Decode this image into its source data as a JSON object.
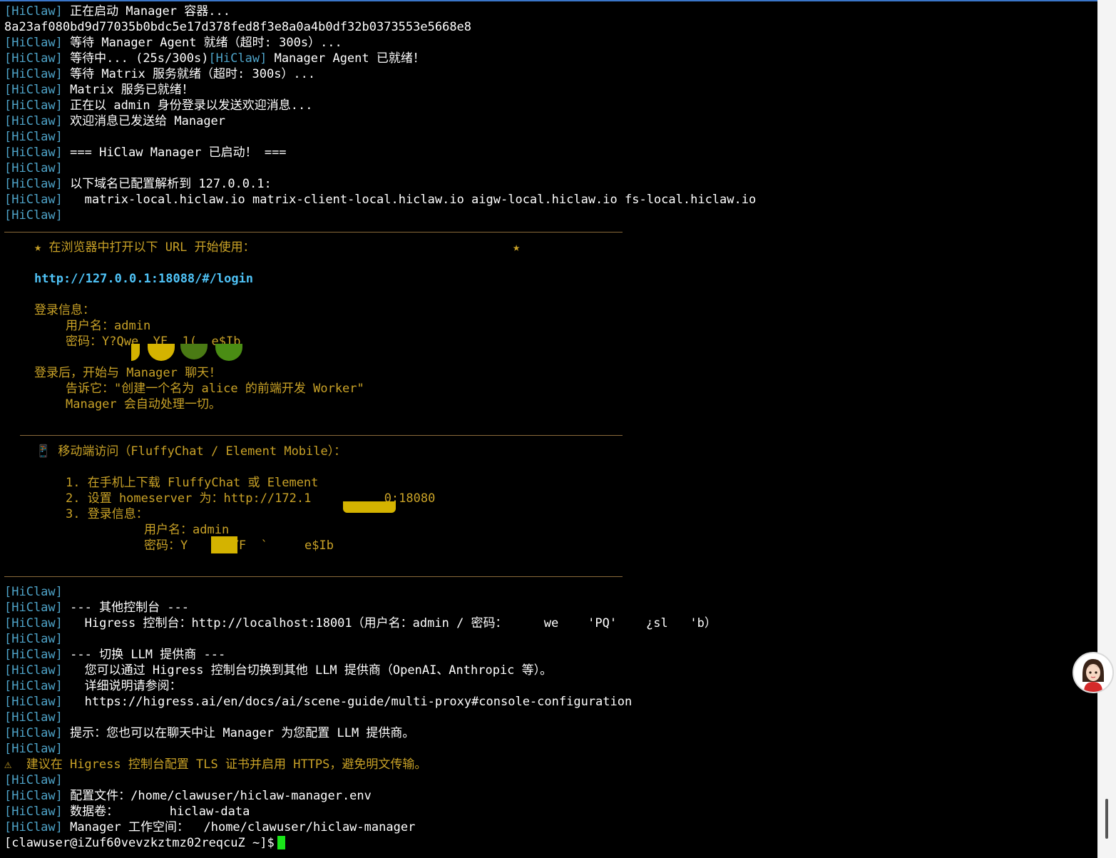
{
  "terminal": {
    "tag": "[HiClaw]",
    "top_lines": [
      "正在启动 Manager 容器...",
      "8a23af080bd9d77035b0bdc5e17d378fed8f3e8a0a4b0df32b0373553e5668e8",
      "等待 Manager Agent 就绪（超时: 300s）...",
      "等待中... (25s/300s)",
      "Manager Agent 已就绪！",
      "等待 Matrix 服务就绪（超时: 300s）...",
      "Matrix 服务已就绪！",
      "正在以 admin 身份登录以发送欢迎消息...",
      "欢迎消息已发送给 Manager",
      "",
      "=== HiClaw Manager 已启动！ ===",
      "",
      "以下域名已配置解析到 127.0.0.1:",
      "  matrix-local.hiclaw.io matrix-client-local.hiclaw.io aigw-local.hiclaw.io fs-local.hiclaw.io",
      ""
    ],
    "box1": {
      "star_line": "★ 在浏览器中打开以下 URL 开始使用：",
      "star_end": "★",
      "url": "http://127.0.0.1:18088/#/login",
      "login_title": "登录信息：",
      "username": "用户名：admin",
      "password": "密码：Y?Qwe  YF  1(  e$Ib",
      "after_login": "登录后，开始与 Manager 聊天！",
      "tell_it": "告诉它：\"创建一个名为 alice 的前端开发 Worker\"",
      "auto": "Manager 会自动处理一切。"
    },
    "box2": {
      "title": "📱 移动端访问（FluffyChat / Element Mobile）：",
      "step1": "1. 在手机上下载 FluffyChat 或 Element",
      "step2": "2. 设置 homeserver 为：http://172.1          0:18080",
      "step3": "3. 登录信息：",
      "username": "用户名：admin",
      "password": "密码：Y      YF  `     e$Ib"
    },
    "bottom_lines": [
      "",
      "--- 其他控制台 ---",
      "  Higress 控制台：http://localhost:18001（用户名：admin / 密码：     we    'PQ'    ¿sl   'b）",
      "",
      "--- 切换 LLM 提供商 ---",
      "  您可以通过 Higress 控制台切换到其他 LLM 提供商（OpenAI、Anthropic 等）。",
      "  详细说明请参阅：",
      "  https://higress.ai/en/docs/ai/scene-guide/multi-proxy#console-configuration",
      "",
      "提示：您也可以在聊天中让 Manager 为您配置 LLM 提供商。",
      ""
    ],
    "warning": "⚠  建议在 Higress 控制台配置 TLS 证书并启用 HTTPS，避免明文传输。",
    "final_lines": [
      "",
      "配置文件：/home/clawuser/hiclaw-manager.env",
      "数据卷：       hiclaw-data",
      "Manager 工作空间：  /home/clawuser/hiclaw-manager"
    ],
    "prompt": "[clawuser@iZuf60vevzkztmz02reqcuZ ~]$"
  },
  "colors": {
    "background": "#000000",
    "tag": "#4ea3c8",
    "highlight": "#c9a227",
    "url": "#4fc3f7",
    "cursor": "#19e619"
  },
  "icons": [
    "star-icon",
    "mobile-phone-icon",
    "warning-icon",
    "assistant-avatar-icon"
  ]
}
